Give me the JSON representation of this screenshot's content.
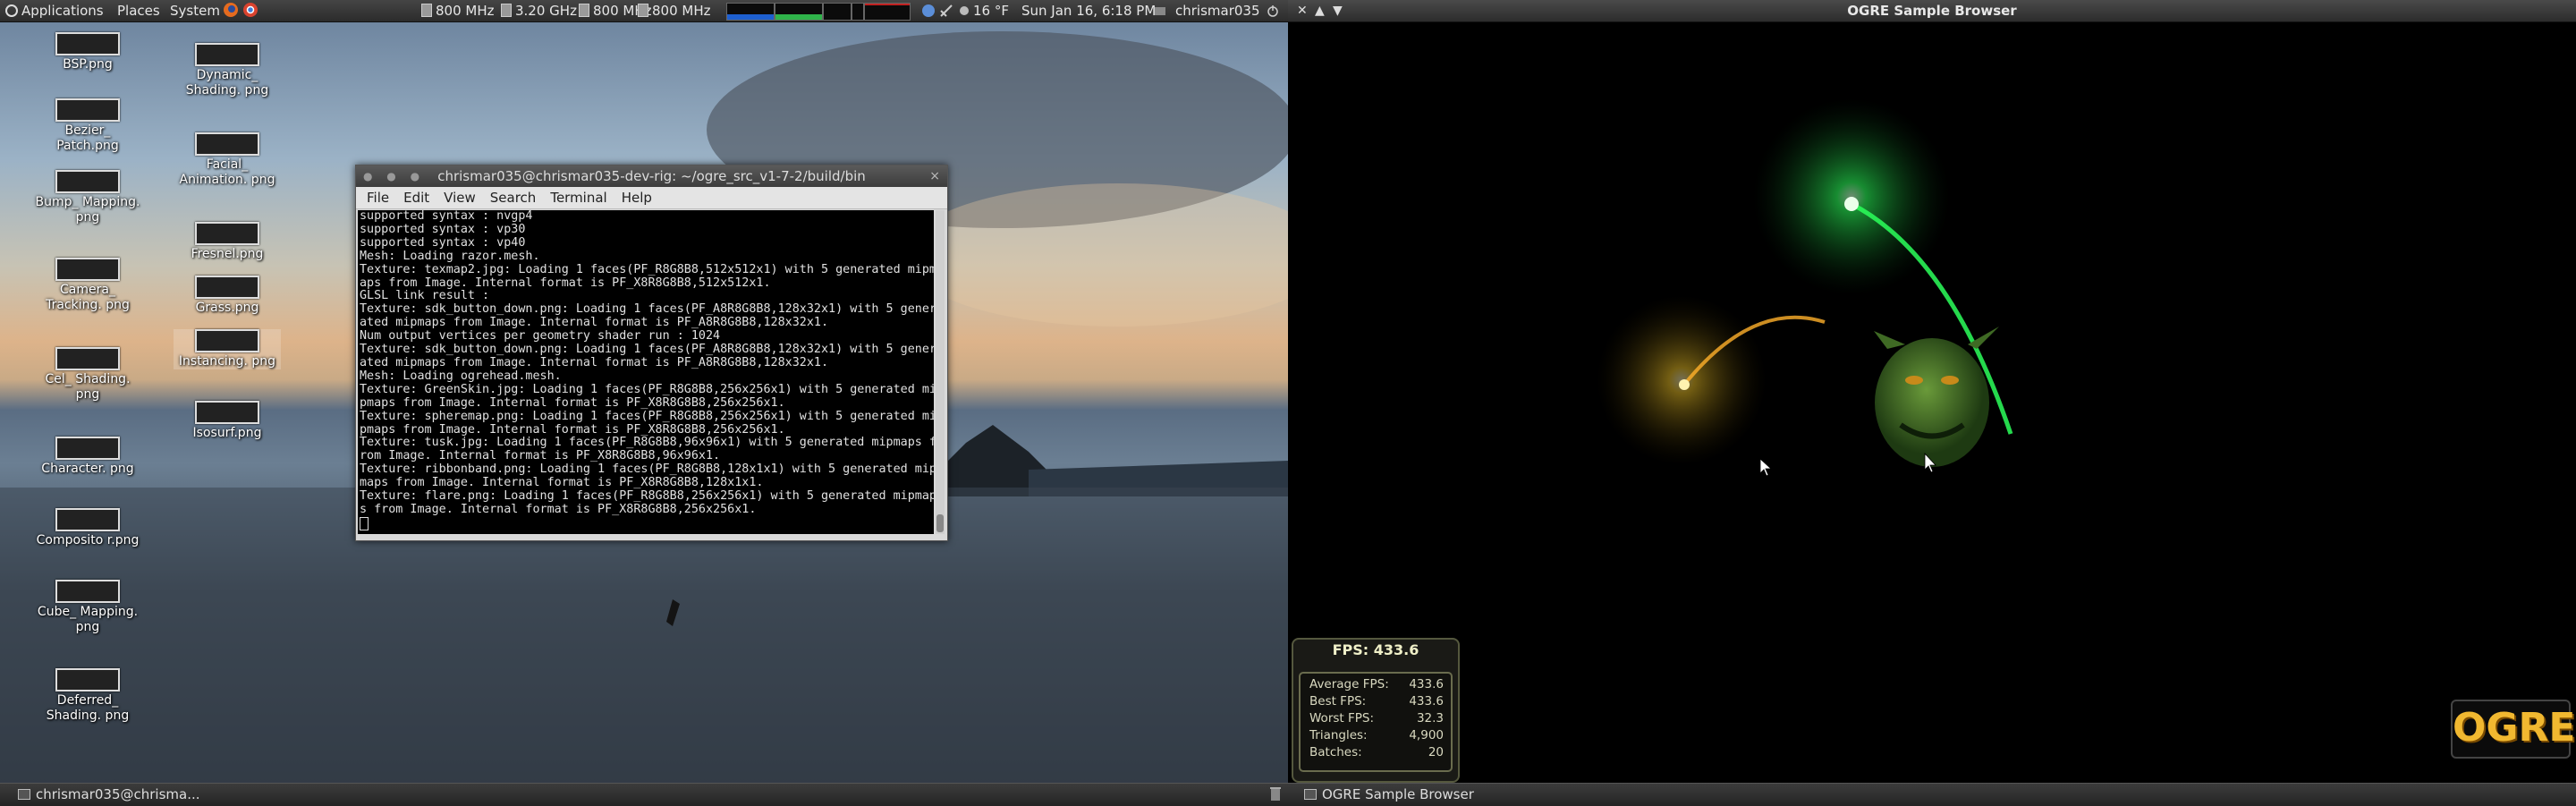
{
  "top_panel": {
    "menus": [
      "Applications",
      "Places",
      "System"
    ],
    "cpu_freqs": [
      "800 MHz",
      "3.20 GHz",
      "800 MHz",
      "800 MHz"
    ],
    "weather": "16 °F",
    "datetime": "Sun Jan 16,  6:18 PM",
    "user": "chrismar035"
  },
  "desktop_icons": [
    {
      "label": "BSP.png"
    },
    {
      "label": "Bezier_ Patch.png"
    },
    {
      "label": "Bump_ Mapping. png"
    },
    {
      "label": "Camera_ Tracking. png"
    },
    {
      "label": "Cel_ Shading. png"
    },
    {
      "label": "Character. png"
    },
    {
      "label": "Composito r.png"
    },
    {
      "label": "Cube_ Mapping. png"
    },
    {
      "label": "Deferred_ Shading. png"
    },
    {
      "label": "Dynamic_ Shading. png"
    },
    {
      "label": "Facial_ Animation. png"
    },
    {
      "label": "Fresnel.png"
    },
    {
      "label": "Grass.png"
    },
    {
      "label": "Instancing. png"
    },
    {
      "label": "Isosurf.png"
    }
  ],
  "terminal": {
    "title": "chrismar035@chrismar035-dev-rig: ~/ogre_src_v1-7-2/build/bin",
    "menu": [
      "File",
      "Edit",
      "View",
      "Search",
      "Terminal",
      "Help"
    ],
    "lines": [
      "supported syntax : nvgp4",
      "supported syntax : vp30",
      "supported syntax : vp40",
      "Mesh: Loading razor.mesh.",
      "Texture: texmap2.jpg: Loading 1 faces(PF_R8G8B8,512x512x1) with 5 generated mipm",
      "aps from Image. Internal format is PF_X8R8G8B8,512x512x1.",
      "GLSL link result :",
      "Texture: sdk_button_down.png: Loading 1 faces(PF_A8R8G8B8,128x32x1) with 5 gener",
      "ated mipmaps from Image. Internal format is PF_A8R8G8B8,128x32x1.",
      "Num output vertices per geometry shader run : 1024",
      "Texture: sdk_button_down.png: Loading 1 faces(PF_A8R8G8B8,128x32x1) with 5 gener",
      "ated mipmaps from Image. Internal format is PF_A8R8G8B8,128x32x1.",
      "Mesh: Loading ogrehead.mesh.",
      "Texture: GreenSkin.jpg: Loading 1 faces(PF_R8G8B8,256x256x1) with 5 generated mi",
      "pmaps from Image. Internal format is PF_X8R8G8B8,256x256x1.",
      "Texture: spheremap.png: Loading 1 faces(PF_R8G8B8,256x256x1) with 5 generated mi",
      "pmaps from Image. Internal format is PF_X8R8G8B8,256x256x1.",
      "Texture: tusk.jpg: Loading 1 faces(PF_R8G8B8,96x96x1) with 5 generated mipmaps f",
      "rom Image. Internal format is PF_X8R8G8B8,96x96x1.",
      "Texture: ribbonband.png: Loading 1 faces(PF_R8G8B8,128x1x1) with 5 generated mip",
      "maps from Image. Internal format is PF_X8R8G8B8,128x1x1.",
      "Texture: flare.png: Loading 1 faces(PF_R8G8B8,256x256x1) with 5 generated mipmap",
      "s from Image. Internal format is PF_X8R8G8B8,256x256x1."
    ]
  },
  "ogre": {
    "title": "OGRE Sample Browser",
    "fps_label": "FPS: 433.6",
    "stats": [
      {
        "label": "Average FPS:",
        "value": "433.6"
      },
      {
        "label": "Best FPS:",
        "value": "433.6"
      },
      {
        "label": "Worst FPS:",
        "value": "32.3"
      },
      {
        "label": "Triangles:",
        "value": "4,900"
      },
      {
        "label": "Batches:",
        "value": "20"
      }
    ],
    "logo_text": "OGRE"
  },
  "taskbar": {
    "terminal_task": "chrismar035@chrisma...",
    "ogre_task": "OGRE Sample Browser"
  },
  "colors": {
    "panel_bg": "#333333",
    "terminal_bg": "#000000",
    "green_light": "#2bff5a",
    "yellow_light": "#ffd02a",
    "ogre_logo": "#f1b830"
  }
}
